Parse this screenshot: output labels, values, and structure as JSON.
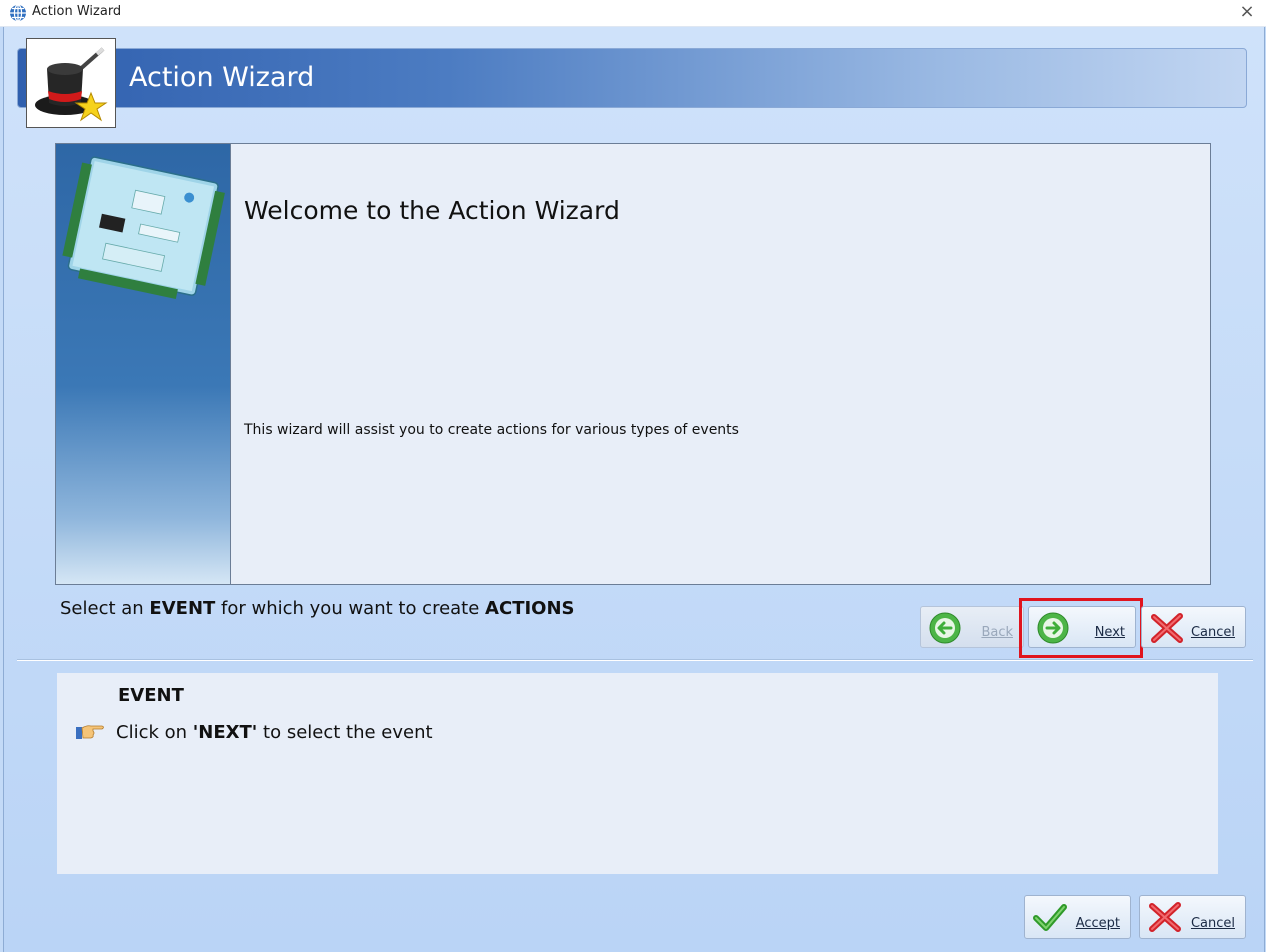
{
  "window": {
    "title": "Action Wizard",
    "close_glyph": "×"
  },
  "banner": {
    "title": "Action Wizard",
    "icon": "magic-hat-icon"
  },
  "welcome": {
    "title": "Welcome to the Action Wizard",
    "description": "This wizard will assist you to create actions for various types of events",
    "image": "controller-board-image"
  },
  "instruction": {
    "part1": "Select an ",
    "bold1": "EVENT",
    "part2": " for which you want to create ",
    "bold2": "ACTIONS"
  },
  "nav": {
    "back_label": "Back",
    "next_label": "Next",
    "cancel_label": "Cancel"
  },
  "event": {
    "heading": "EVENT",
    "hint_prefix": "Click on ",
    "hint_bold": "'NEXT'",
    "hint_suffix": " to select the event"
  },
  "footer": {
    "accept_label": "Accept",
    "cancel_label": "Cancel"
  },
  "colors": {
    "accent": "#2f5fae",
    "highlight": "#e0141e",
    "green": "#3fae3a",
    "red": "#d2232a"
  }
}
